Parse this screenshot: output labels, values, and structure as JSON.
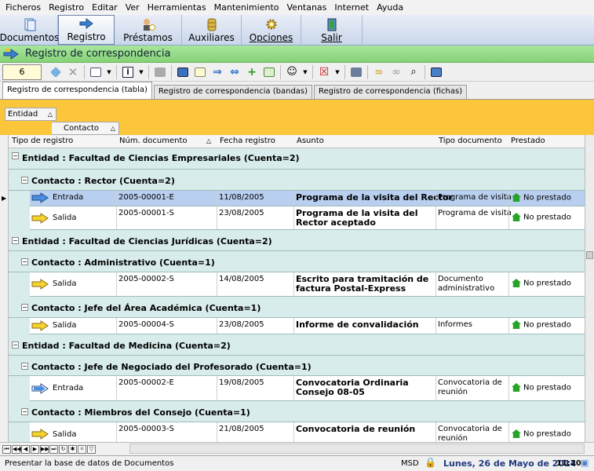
{
  "menu": [
    "Ficheros",
    "Registro",
    "Editar",
    "Ver",
    "Herramientas",
    "Mantenimiento",
    "Ventanas",
    "Internet",
    "Ayuda"
  ],
  "nav": [
    {
      "label": "Documentos",
      "icon": "documents-icon"
    },
    {
      "label": "Registro",
      "icon": "register-icon"
    },
    {
      "label": "Préstamos",
      "icon": "loans-icon"
    },
    {
      "label": "Auxiliares",
      "icon": "auxiliary-icon"
    },
    {
      "label": "Opciones",
      "icon": "options-icon"
    },
    {
      "label": "Salir",
      "icon": "exit-icon"
    }
  ],
  "window_title": "Registro de correspondencia",
  "toolbar": {
    "record_field": "6"
  },
  "tabs": [
    "Registro de correspondencia (tabla)",
    "Registro de correspondencia (bandas)",
    "Registro de correspondencia (fichas)"
  ],
  "grouping": [
    "Entidad",
    "Contacto"
  ],
  "columns": [
    "Tipo de registro",
    "Núm. documento",
    "Fecha registro",
    "Asunto",
    "Tipo documento",
    "Prestado"
  ],
  "groups": {
    "e1": "Entidad : Facultad de Ciencias Empresariales (Cuenta=2)",
    "c1": "Contacto : Rector (Cuenta=2)",
    "e2": "Entidad : Facultad de Ciencias Jurídicas (Cuenta=2)",
    "c2": "Contacto : Administrativo (Cuenta=1)",
    "c3": "Contacto : Jefe del Área Académica (Cuenta=1)",
    "e3": "Entidad : Facultad de Medicina (Cuenta=2)",
    "c4": "Contacto : Jefe de Negociado del Profesorado (Cuenta=1)",
    "c5": "Contacto : Miembros del Consejo (Cuenta=1)"
  },
  "rows": {
    "r1": {
      "tipo": "Entrada",
      "num": "2005-00001-E",
      "fecha": "11/08/2005",
      "asunto": "Programa de la visita del Rector",
      "tipodoc": "Programa de visita",
      "prestado": "No prestado"
    },
    "r2": {
      "tipo": "Salida",
      "num": "2005-00001-S",
      "fecha": "23/08/2005",
      "asunto": "Programa de la visita del Rector aceptado",
      "tipodoc": "Programa de visita",
      "prestado": "No prestado"
    },
    "r3": {
      "tipo": "Salida",
      "num": "2005-00002-S",
      "fecha": "14/08/2005",
      "asunto": "Escrito para tramitación de factura Postal-Express",
      "tipodoc": "Documento administrativo",
      "prestado": "No prestado"
    },
    "r4": {
      "tipo": "Salida",
      "num": "2005-00004-S",
      "fecha": "23/08/2005",
      "asunto": "Informe de convalidación",
      "tipodoc": "Informes",
      "prestado": "No prestado"
    },
    "r5": {
      "tipo": "Entrada",
      "num": "2005-00002-E",
      "fecha": "19/08/2005",
      "asunto": "Convocatoria Ordinaria Consejo 08-05",
      "tipodoc": "Convocatoria de reunión",
      "prestado": "No prestado"
    },
    "r6": {
      "tipo": "Salida",
      "num": "2005-00003-S",
      "fecha": "21/08/2005",
      "asunto": "Convocatoria de reunión",
      "tipodoc": "Convocatoria de reunión",
      "prestado": "No prestado"
    }
  },
  "status": {
    "message": "Presentar la base de datos de Documentos",
    "msd": "MSD",
    "date": "Lunes, 26 de Mayo de 2014",
    "time": "11:20"
  },
  "colors": {
    "accent_green": "#86d278",
    "group_yellow": "#fbc63a",
    "grid_bg": "#d7eceb",
    "selected": "#b8cff0"
  }
}
